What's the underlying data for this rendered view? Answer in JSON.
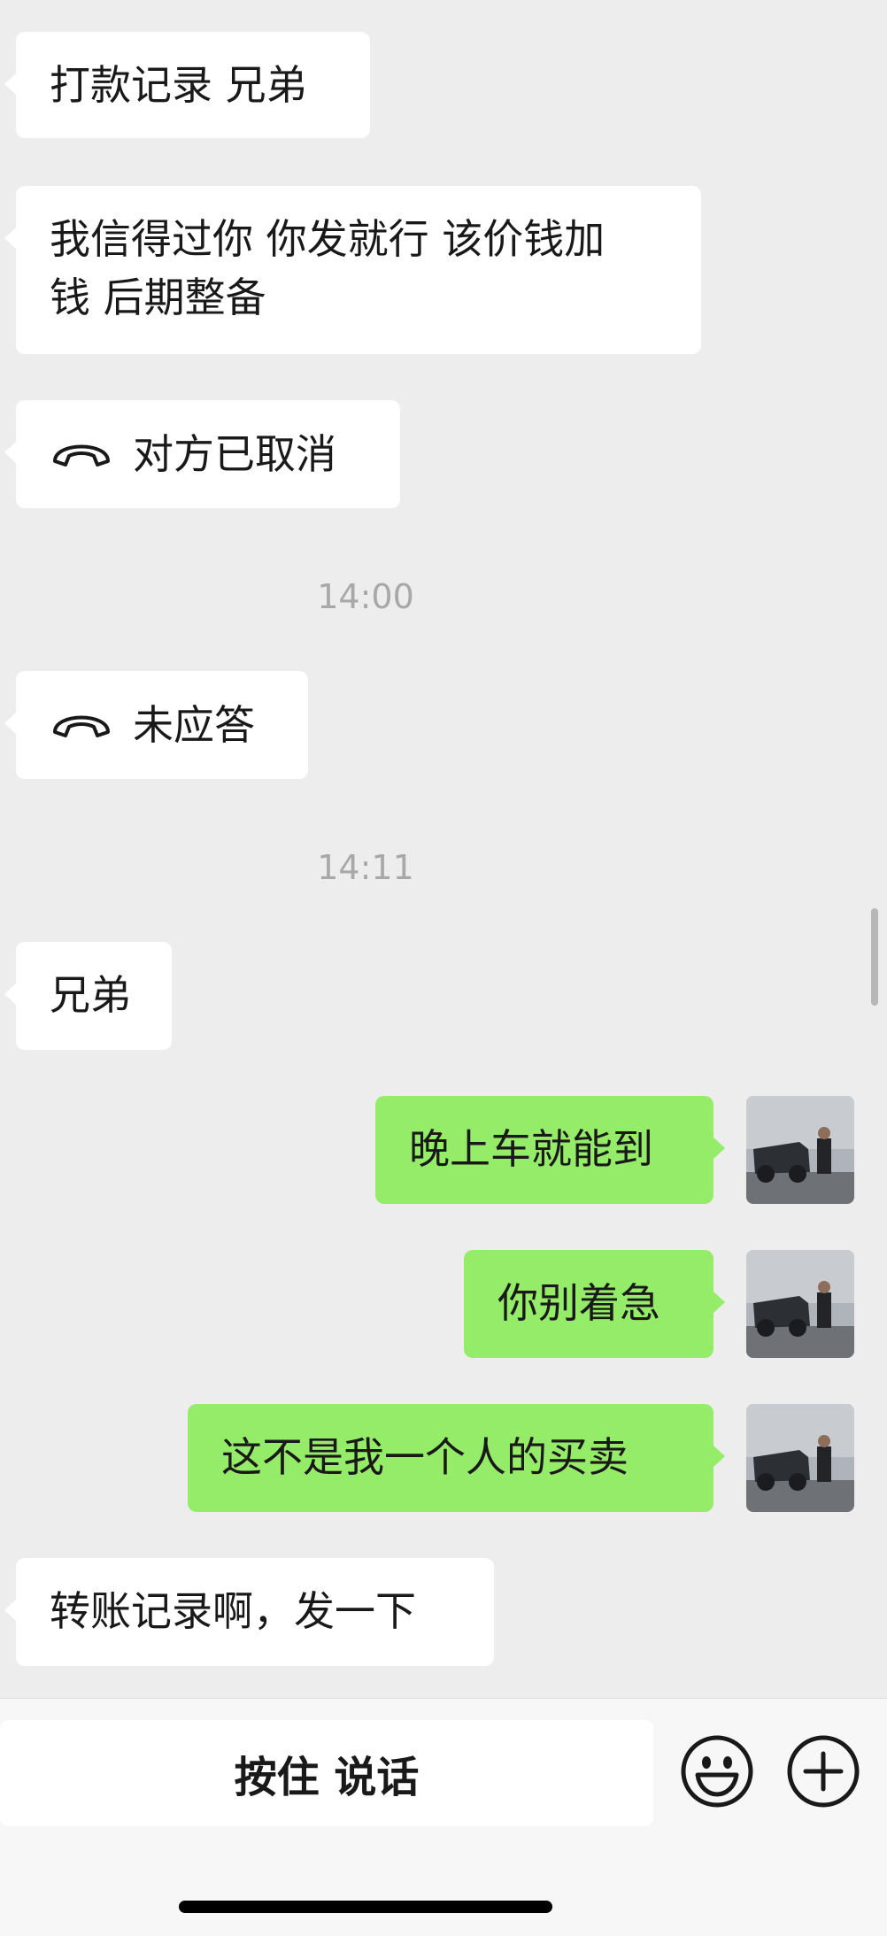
{
  "messages": [
    {
      "side": "in",
      "text": "打款记录 兄弟"
    },
    {
      "side": "in",
      "line1": "我信得过你 你发就行 该价钱加",
      "line2": "钱 后期整备"
    },
    {
      "side": "in",
      "type": "call",
      "icon": "phone-hangup-icon",
      "text": "对方已取消"
    },
    {
      "type": "timestamp",
      "text": "14:00"
    },
    {
      "side": "in",
      "type": "call",
      "icon": "phone-hangup-icon",
      "text": "未应答"
    },
    {
      "type": "timestamp",
      "text": "14:11"
    },
    {
      "side": "in",
      "text": "兄弟"
    },
    {
      "side": "out",
      "text": "晚上车就能到"
    },
    {
      "side": "out",
      "text": "你别着急"
    },
    {
      "side": "out",
      "text": "这不是我一个人的买卖"
    },
    {
      "side": "in",
      "text": "转账记录啊，发一下"
    }
  ],
  "input_bar": {
    "voice_label": "按住 说话",
    "emoji_icon": "emoji-icon",
    "plus_icon": "plus-icon"
  },
  "colors": {
    "background": "#ededed",
    "incoming_bubble": "#ffffff",
    "outgoing_bubble": "#95ec69",
    "timestamp": "#a8a8a8"
  }
}
